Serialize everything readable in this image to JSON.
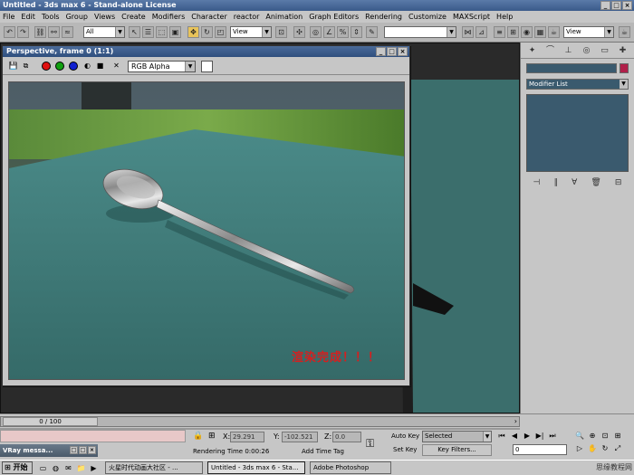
{
  "window": {
    "title": "Untitled - 3ds max 6 - Stand-alone License",
    "controls": [
      "_",
      "□",
      "×"
    ]
  },
  "menu": [
    "File",
    "Edit",
    "Tools",
    "Group",
    "Views",
    "Create",
    "Modifiers",
    "Character",
    "reactor",
    "Animation",
    "Graph Editors",
    "Rendering",
    "Customize",
    "MAXScript",
    "Help"
  ],
  "toolbar": {
    "selection_filter": "All",
    "reference_coord": "View",
    "named_selection": "",
    "view_dd": "View"
  },
  "render_window": {
    "title": "Perspective, frame 0 (1:1)",
    "channel": "RGB Alpha",
    "caption": "渲染完成！！！"
  },
  "command_panel": {
    "modifier_list": "Modifier List"
  },
  "timeline": {
    "frame_label": "0 / 100"
  },
  "status": {
    "x_label": "X:",
    "x_value": "29.291",
    "y_label": "Y:",
    "y_value": "-102.521",
    "z_label": "Z:",
    "z_value": "0.0",
    "render_time": "Rendering Time  0:00:26",
    "add_time_tag": "Add Time Tag",
    "auto_key": "Auto Key",
    "set_key": "Set Key",
    "selected": "Selected",
    "key_filters": "Key Filters...",
    "current_frame": "0"
  },
  "vray_window": {
    "title": "VRay messa..."
  },
  "taskbar": {
    "start": "开始",
    "tasks": [
      "火星时代动画大社区 - ...",
      "Untitled - 3ds max 6 - Sta...",
      "Adobe Photoshop"
    ],
    "tray_text": "思缘教程网 WWW.MISSYUAN.NET"
  },
  "colors": {
    "floor": "#3b7a78",
    "title_blue": "#3a5a8a",
    "active_tool": "#e8c35a",
    "caption_red": "#d42020",
    "object_color": "#b0204a"
  }
}
